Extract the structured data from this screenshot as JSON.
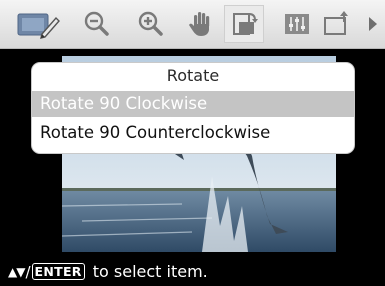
{
  "toolbar": {
    "icons": [
      "edit-icon",
      "zoom-out-icon",
      "zoom-in-icon",
      "hand-icon",
      "rotate-icon",
      "adjust-icon",
      "frame-icon",
      "more-arrow-icon"
    ],
    "selected_icon": "rotate-icon",
    "accent_color": "#6e6e6e",
    "edit_icon_color": "#6f86a6"
  },
  "menu": {
    "title": "Rotate",
    "items": [
      {
        "label": "Rotate 90 Clockwise",
        "selected": true
      },
      {
        "label": "Rotate 90 Counterclockwise",
        "selected": false
      }
    ],
    "selected_bg": "#c4c4c4"
  },
  "status": {
    "arrows": "▲▼",
    "slash": "/",
    "enter_key": "ENTER",
    "hint": "to select item."
  }
}
